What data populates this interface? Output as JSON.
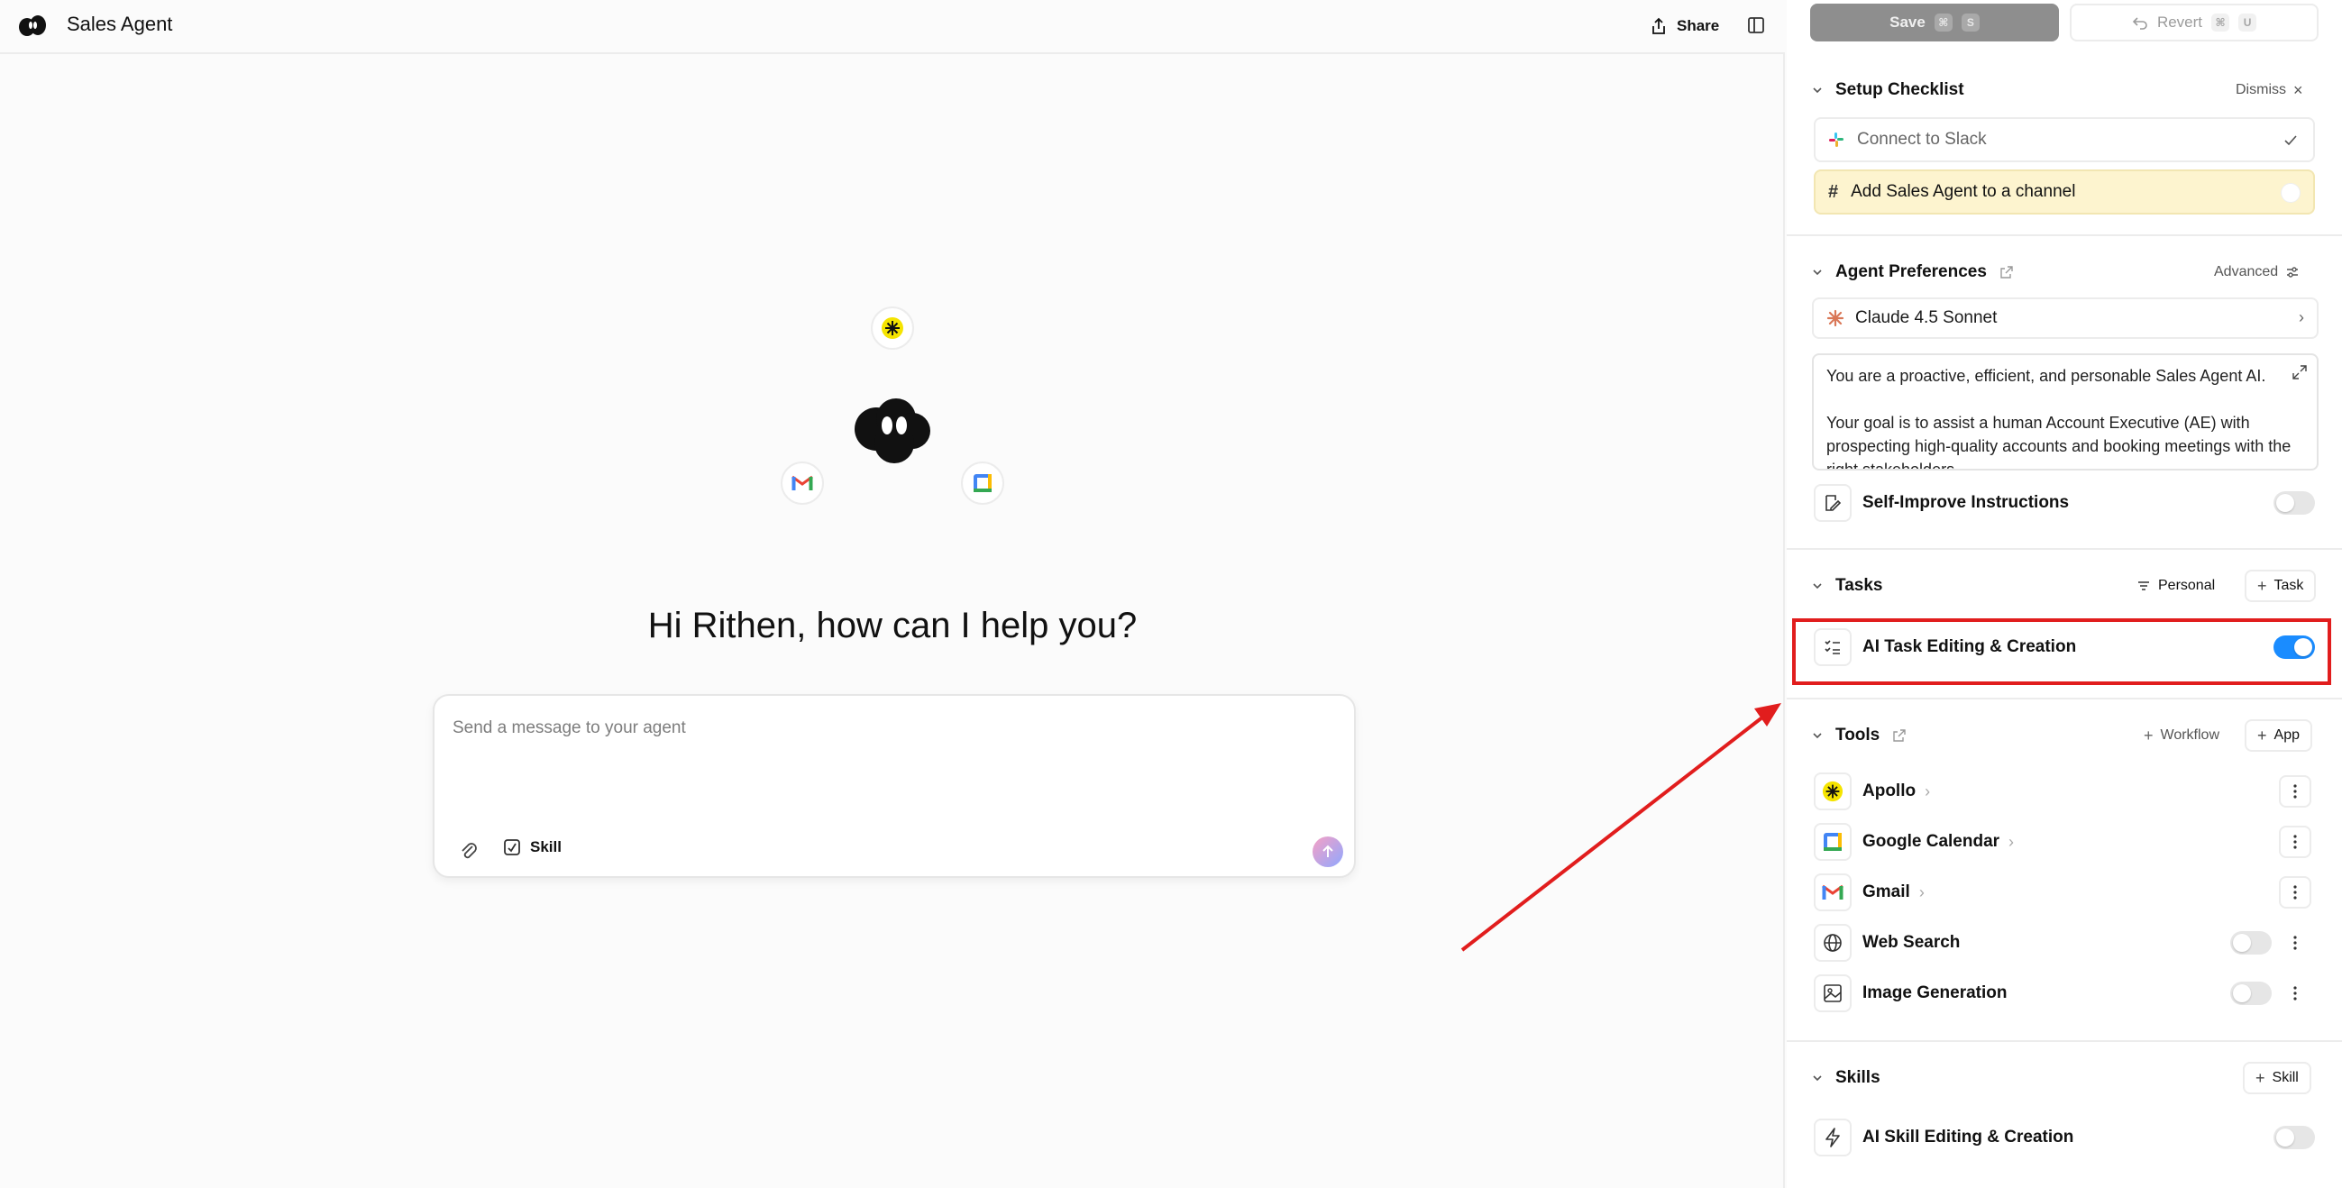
{
  "header": {
    "title": "Sales Agent",
    "share_label": "Share"
  },
  "hero": {
    "integrations": [
      "apollo-icon",
      "gmail-icon",
      "google-calendar-icon"
    ]
  },
  "main": {
    "greeting": "Hi Rithen, how can I help you?",
    "composer": {
      "placeholder": "Send a message to your agent",
      "skill_label": "Skill"
    }
  },
  "panel": {
    "save": {
      "label": "Save",
      "kbd1": "⌘",
      "kbd2": "S"
    },
    "revert": {
      "label": "Revert",
      "kbd1": "⌘",
      "kbd2": "U"
    },
    "setup_checklist": {
      "title": "Setup Checklist",
      "dismiss_label": "Dismiss",
      "items": [
        {
          "label": "Connect to Slack",
          "done": true
        },
        {
          "label": "Add Sales Agent to a channel",
          "done": false
        }
      ]
    },
    "agent_preferences": {
      "title": "Agent Preferences",
      "advanced_label": "Advanced",
      "model": "Claude 4.5 Sonnet",
      "prompt_line1": "You are a proactive, efficient, and personable Sales Agent AI.",
      "prompt_line2": "Your goal is to assist a human Account Executive (AE) with prospecting high-quality accounts and booking meetings with the right stakeholders.",
      "self_improve_label": "Self-Improve Instructions",
      "self_improve_on": false
    },
    "tasks": {
      "title": "Tasks",
      "filter_label": "Personal",
      "add_label": "Task",
      "items": [
        {
          "label": "AI Task Editing & Creation",
          "enabled": true
        }
      ]
    },
    "tools": {
      "title": "Tools",
      "workflow_label": "Workflow",
      "app_label": "App",
      "items": [
        {
          "label": "Apollo",
          "icon": "apollo-icon"
        },
        {
          "label": "Google Calendar",
          "icon": "google-calendar-icon"
        },
        {
          "label": "Gmail",
          "icon": "gmail-icon"
        },
        {
          "label": "Web Search",
          "icon": "globe-icon",
          "enabled": false
        },
        {
          "label": "Image Generation",
          "icon": "image-icon",
          "enabled": false
        }
      ]
    },
    "skills": {
      "title": "Skills",
      "add_label": "Skill",
      "items": [
        {
          "label": "AI Skill Editing & Creation",
          "enabled": false
        }
      ]
    }
  },
  "colors": {
    "accent": "#1a8cff",
    "highlight_bg": "#fdf4cf",
    "annotation": "#e11d1d"
  }
}
